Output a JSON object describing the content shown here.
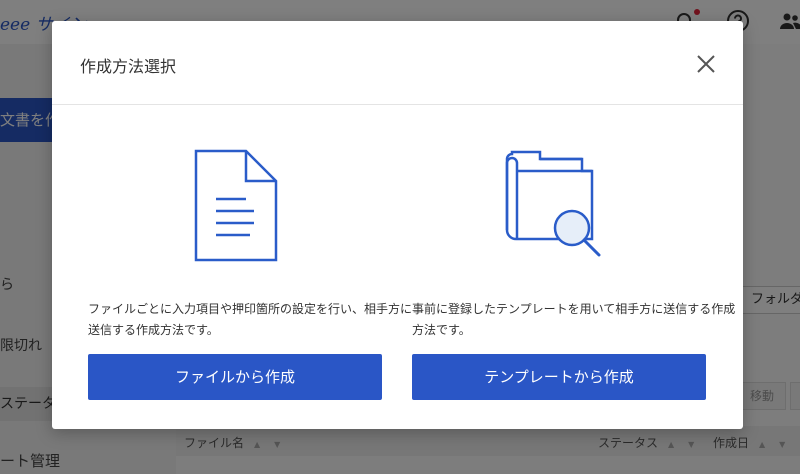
{
  "app": {
    "logo_text": "eee サイン"
  },
  "sidebar": {
    "create_label": "文書を作成",
    "items": [
      {
        "label": "ら"
      },
      {
        "label": "限切れ"
      },
      {
        "label": "ステータス"
      },
      {
        "label": "ート管理"
      }
    ]
  },
  "main": {
    "folder_label": "フォルダ",
    "move_label": "移動",
    "table": {
      "columns": [
        "ファイル名",
        "ステータス",
        "作成日"
      ]
    }
  },
  "modal": {
    "title": "作成方法選択",
    "options": [
      {
        "icon": "document-icon",
        "description": "ファイルごとに入力項目や押印箇所の設定を行い、相手方に送信する作成方法です。",
        "button_label": "ファイルから作成"
      },
      {
        "icon": "folder-search-icon",
        "description": "事前に登録したテンプレートを用いて相手方に送信する作成方法です。",
        "button_label": "テンプレートから作成"
      }
    ]
  },
  "colors": {
    "primary": "#2a56c6",
    "icon_stroke": "#2a5cc9",
    "notification": "#e2243b"
  }
}
